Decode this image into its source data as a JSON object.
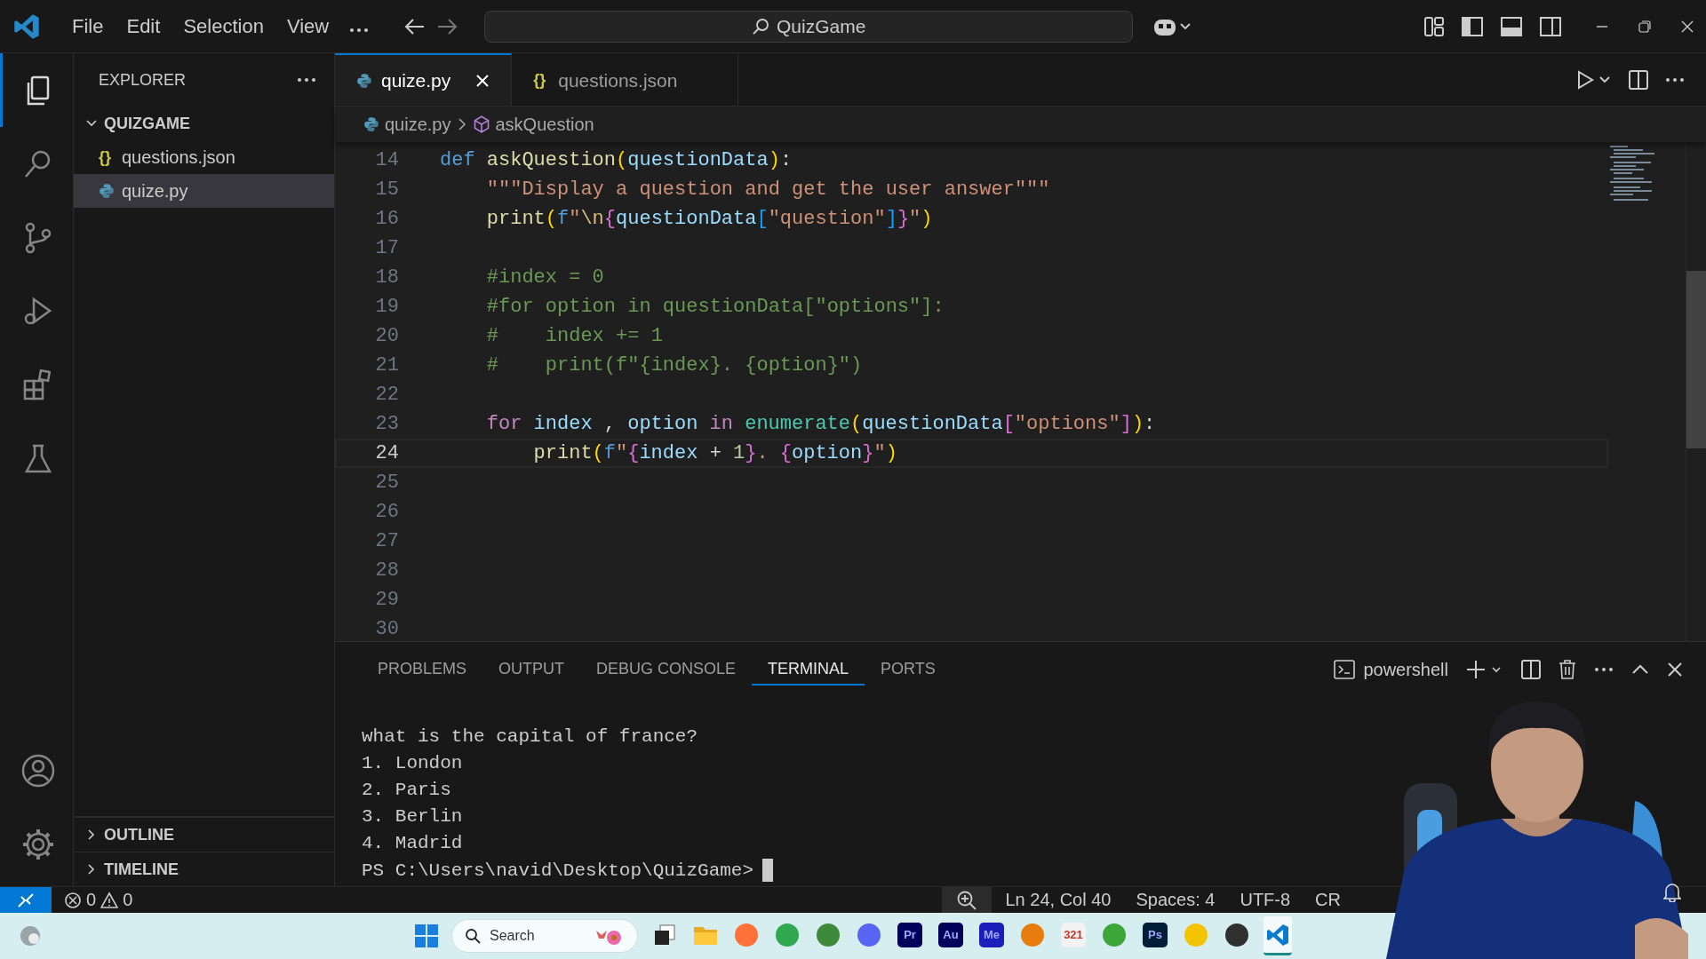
{
  "title_bar": {
    "menus": [
      "File",
      "Edit",
      "Selection",
      "View"
    ],
    "search": "QuizGame"
  },
  "activity_bar": [
    {
      "kind": "explorer",
      "selected": true
    },
    {
      "kind": "search",
      "selected": false
    },
    {
      "kind": "source-control",
      "selected": false
    },
    {
      "kind": "run-debug",
      "selected": false
    },
    {
      "kind": "extensions",
      "selected": false
    },
    {
      "kind": "testing",
      "selected": false
    }
  ],
  "sidebar": {
    "title": "EXPLORER",
    "folder": {
      "name": "QUIZGAME",
      "expanded": true,
      "files": [
        {
          "name": "questions.json",
          "kind": "json",
          "icon": "{}",
          "selected": false
        },
        {
          "name": "quize.py",
          "kind": "python",
          "selected": true
        }
      ]
    },
    "sections": [
      {
        "name": "OUTLINE",
        "expanded": false
      },
      {
        "name": "TIMELINE",
        "expanded": false
      }
    ]
  },
  "tabs": [
    {
      "label": "quize.py",
      "kind": "python",
      "selected": true
    },
    {
      "label": "questions.json",
      "kind": "json",
      "icon": "{}",
      "selected": false
    }
  ],
  "breadcrumb": [
    {
      "label": "quize.py",
      "kind": "python"
    },
    {
      "label": "askQuestion",
      "kind": "symbol"
    }
  ],
  "editor": {
    "lines": [
      {
        "number": "14",
        "current": false,
        "tokens": [
          {
            "text": "def",
            "kind": "kw"
          },
          {
            "text": "askQuestion",
            "kind": "fn",
            "space": true
          },
          {
            "text": "(",
            "kind": "b1"
          },
          {
            "text": "questionData",
            "kind": "var"
          },
          {
            "text": ")",
            "kind": "b1"
          },
          {
            "text": ":",
            "kind": "p"
          }
        ],
        "children": [
          {
            "number": "15",
            "current": false,
            "tokens": [
              {
                "text": "\"\"\"Display a question and get the user answer\"\"\"",
                "kind": "str"
              }
            ]
          },
          {
            "number": "16",
            "current": false,
            "tokens": [
              {
                "text": "print",
                "kind": "fn"
              },
              {
                "text": "(",
                "kind": "b1"
              },
              {
                "text": "f",
                "kind": "kw"
              },
              {
                "text": "\"",
                "kind": "str"
              },
              {
                "text": "\\n",
                "kind": "esc"
              },
              {
                "text": "{",
                "kind": "b2"
              },
              {
                "text": "questionData",
                "kind": "var"
              },
              {
                "text": "[",
                "kind": "b3"
              },
              {
                "text": "\"question\"",
                "kind": "str"
              },
              {
                "text": "]",
                "kind": "b3"
              },
              {
                "text": "}",
                "kind": "b2"
              },
              {
                "text": "\"",
                "kind": "str"
              },
              {
                "text": ")",
                "kind": "b1"
              }
            ]
          },
          {
            "number": "17",
            "current": false
          },
          {
            "number": "18",
            "current": false,
            "tokens": [
              {
                "text": "#index = 0",
                "kind": "com"
              }
            ]
          },
          {
            "number": "19",
            "current": false,
            "tokens": [
              {
                "text": "#for option in questionData[\"options\"]:",
                "kind": "com"
              }
            ]
          },
          {
            "number": "20",
            "current": false,
            "tokens": [
              {
                "text": "#    index += 1",
                "kind": "com"
              }
            ]
          },
          {
            "number": "21",
            "current": false,
            "tokens": [
              {
                "text": "#    print(f\"{index}. {option}\")",
                "kind": "com"
              }
            ]
          },
          {
            "number": "22",
            "current": false
          },
          {
            "number": "23",
            "current": false,
            "tokens": [
              {
                "text": "for",
                "kind": "ctrl"
              },
              {
                "text": "index",
                "kind": "var",
                "space": true
              },
              {
                "text": ",",
                "kind": "p",
                "space": true
              },
              {
                "text": "option",
                "kind": "var",
                "space": true
              },
              {
                "text": "in",
                "kind": "ctrl",
                "space": true
              },
              {
                "text": "enumerate",
                "kind": "builtin",
                "space": true
              },
              {
                "text": "(",
                "kind": "b1"
              },
              {
                "text": "questionData",
                "kind": "var"
              },
              {
                "text": "[",
                "kind": "b2"
              },
              {
                "text": "\"options\"",
                "kind": "str"
              },
              {
                "text": "]",
                "kind": "b2"
              },
              {
                "text": ")",
                "kind": "b1"
              },
              {
                "text": ":",
                "kind": "p"
              }
            ],
            "children": [
              {
                "number": "24",
                "current": true,
                "tokens": [
                  {
                    "text": "print",
                    "kind": "fn"
                  },
                  {
                    "text": "(",
                    "kind": "b1"
                  },
                  {
                    "text": "f",
                    "kind": "kw"
                  },
                  {
                    "text": "\"",
                    "kind": "str"
                  },
                  {
                    "text": "{",
                    "kind": "b2"
                  },
                  {
                    "text": "index",
                    "kind": "var"
                  },
                  {
                    "text": "+",
                    "kind": "p",
                    "space": true
                  },
                  {
                    "text": "1",
                    "kind": "num",
                    "space": true
                  },
                  {
                    "text": "}",
                    "kind": "b2"
                  },
                  {
                    "text": ".",
                    "kind": "str"
                  },
                  {
                    "text": "{",
                    "kind": "b2",
                    "space": true
                  },
                  {
                    "text": "option",
                    "kind": "var"
                  },
                  {
                    "text": "}",
                    "kind": "b2"
                  },
                  {
                    "text": "\"",
                    "kind": "str"
                  },
                  {
                    "text": ")",
                    "kind": "b1"
                  }
                ]
              }
            ]
          }
        ]
      },
      {
        "number": "25",
        "current": false
      },
      {
        "number": "26",
        "current": false
      },
      {
        "number": "27",
        "current": false
      },
      {
        "number": "28",
        "current": false
      },
      {
        "number": "29",
        "current": false
      },
      {
        "number": "30",
        "current": false
      }
    ]
  },
  "panel": {
    "tabs": [
      {
        "label": "PROBLEMS",
        "selected": false
      },
      {
        "label": "OUTPUT",
        "selected": false
      },
      {
        "label": "DEBUG CONSOLE",
        "selected": false
      },
      {
        "label": "TERMINAL",
        "selected": true
      },
      {
        "label": "PORTS",
        "selected": false
      }
    ],
    "shell": "powershell",
    "terminal_lines": [
      "what is the capital of france?",
      "1. London",
      "2. Paris",
      "3. Berlin",
      "4. Madrid"
    ],
    "prompt": "PS C:\\Users\\navid\\Desktop\\QuizGame>"
  },
  "status_bar": {
    "errors": "0",
    "warnings": "0",
    "items": [
      "Ln 24, Col 40",
      "Spaces: 4",
      "UTF-8",
      "CR"
    ]
  },
  "taskbar": {
    "search": "Search",
    "apps": [
      {
        "kind": "taskview",
        "selected": false
      },
      {
        "kind": "folder",
        "selected": false
      },
      {
        "kind": "circle",
        "color": "#ff7139",
        "selected": false
      },
      {
        "kind": "circle",
        "color": "#2fa84f",
        "selected": false
      },
      {
        "kind": "circle",
        "color": "#3f8a3a",
        "selected": false
      },
      {
        "kind": "circle",
        "color": "#5865f2",
        "selected": false
      },
      {
        "kind": "tile",
        "label": "Pr",
        "color": "#00005b",
        "selected": false
      },
      {
        "kind": "tile",
        "label": "Au",
        "color": "#00005b",
        "selected": false
      },
      {
        "kind": "tile",
        "label": "Me",
        "color": "#1b1eb8",
        "selected": false
      },
      {
        "kind": "circle",
        "color": "#e87d0d",
        "selected": false
      },
      {
        "kind": "tile",
        "label": "321",
        "color": "#f2f2f2",
        "selected": false
      },
      {
        "kind": "circle",
        "color": "#3da639",
        "selected": false
      },
      {
        "kind": "tile",
        "label": "Ps",
        "color": "#001e36",
        "selected": false
      },
      {
        "kind": "circle",
        "color": "#f5c400",
        "selected": false
      },
      {
        "kind": "circle",
        "color": "#303030",
        "selected": false
      },
      {
        "kind": "editor",
        "selected": true
      }
    ]
  }
}
